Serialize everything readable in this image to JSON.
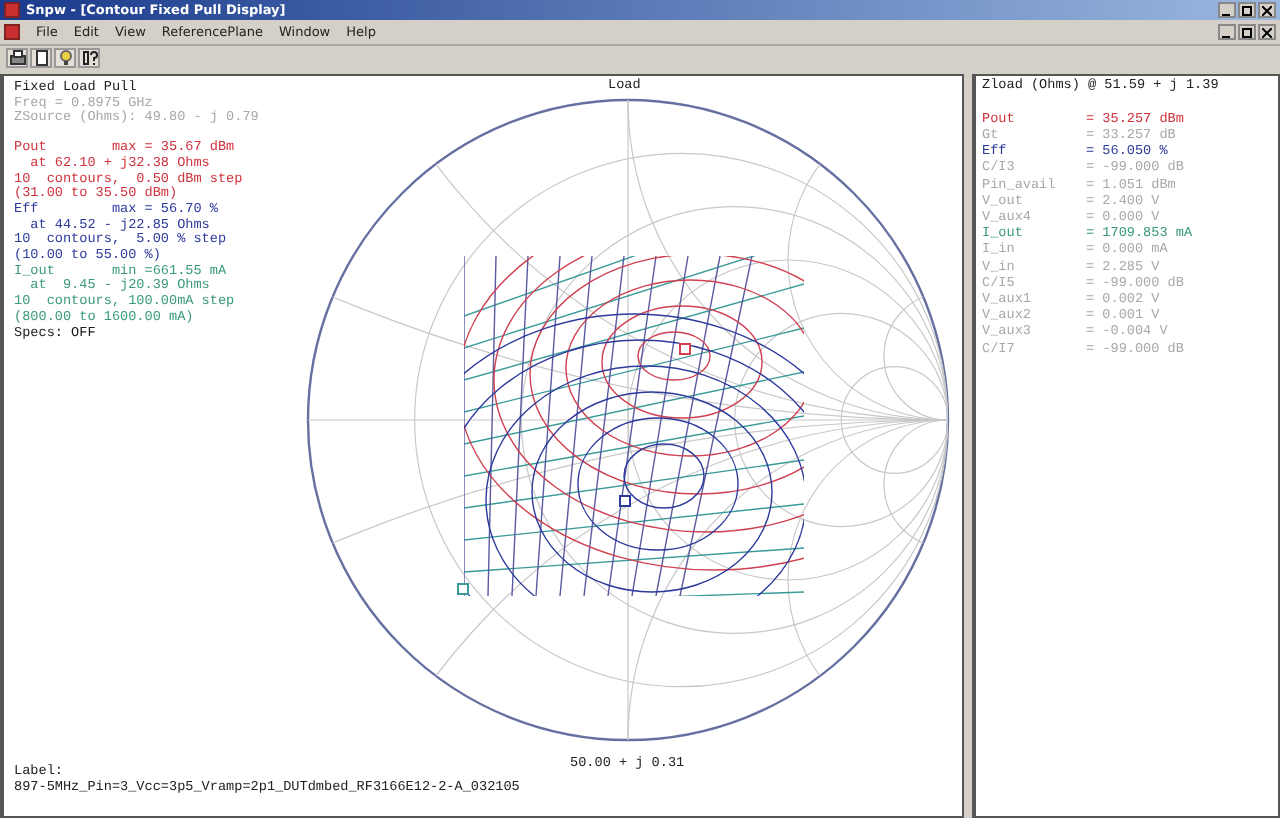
{
  "window": {
    "title": "Snpw - [Contour Fixed Pull Display]"
  },
  "menu": [
    "File",
    "Edit",
    "View",
    "ReferencePlane",
    "Window",
    "Help"
  ],
  "plot": {
    "info": [
      {
        "text": "Fixed Load Pull",
        "color": "#202020"
      },
      {
        "text": "Freq = 0.8975 GHz",
        "color": "#a8a8a8"
      },
      {
        "text": "ZSource (Ohms): 49.80 - j 0.79",
        "color": "#a8a8a8"
      }
    ],
    "results": [
      {
        "text": "Pout        max = 35.67 dBm",
        "color": "#d0323c"
      },
      {
        "text": "  at 62.10 + j32.38 Ohms",
        "color": "#d0323c"
      },
      {
        "text": "10  contours,  0.50 dBm step",
        "color": "#d0323c"
      },
      {
        "text": "(31.00 to 35.50 dBm)",
        "color": "#d0323c"
      },
      {
        "text": "Eff         max = 56.70 %",
        "color": "#2c3a9c"
      },
      {
        "text": "  at 44.52 - j22.85 Ohms",
        "color": "#2c3a9c"
      },
      {
        "text": "10  contours,  5.00 % step",
        "color": "#2c3a9c"
      },
      {
        "text": "(10.00 to 55.00 %)",
        "color": "#2c3a9c"
      },
      {
        "text": "I_out       min =661.55 mA",
        "color": "#3a9a7a"
      },
      {
        "text": "  at  9.45 - j20.39 Ohms",
        "color": "#3a9a7a"
      },
      {
        "text": "10  contours, 100.00mA step",
        "color": "#3a9a7a"
      },
      {
        "text": "(800.00 to 1600.00 mA)",
        "color": "#3a9a7a"
      },
      {
        "text": "Specs: OFF",
        "color": "#202020"
      }
    ],
    "chart_title": "Load",
    "readout": "50.00 + j 0.31",
    "label_caption": "Label:",
    "label_value": "897-5MHz_Pin=3_Vcc=3p5_Vramp=2p1_DUTdmbed_RF3166E12-2-A_032105"
  },
  "side": {
    "header": "Zload (Ohms) @ 51.59 + j 1.39",
    "rows": [
      {
        "name": "Pout",
        "value": "= 35.257 dBm",
        "color": "#d0323c"
      },
      {
        "name": "Gt",
        "value": "= 33.257 dB",
        "color": "#a8a8a8"
      },
      {
        "name": "Eff",
        "value": "= 56.050 %",
        "color": "#2c3a9c"
      },
      {
        "name": "C/I3",
        "value": "= -99.000 dB",
        "color": "#a8a8a8"
      },
      {
        "name": "Pin_avail",
        "value": "= 1.051 dBm",
        "color": "#a8a8a8"
      },
      {
        "name": "V_out",
        "value": "= 2.400 V",
        "color": "#a8a8a8"
      },
      {
        "name": "V_aux4",
        "value": "= 0.000 V",
        "color": "#a8a8a8"
      },
      {
        "name": "I_out",
        "value": "= 1709.853 mA",
        "color": "#3a9a7a"
      },
      {
        "name": "I_in",
        "value": "= 0.000 mA",
        "color": "#a8a8a8"
      },
      {
        "name": "V_in",
        "value": "= 2.285 V",
        "color": "#a8a8a8"
      },
      {
        "name": "C/I5",
        "value": "= -99.000 dB",
        "color": "#a8a8a8"
      },
      {
        "name": "V_aux1",
        "value": "= 0.002 V",
        "color": "#a8a8a8"
      },
      {
        "name": "V_aux2",
        "value": "= 0.001 V",
        "color": "#a8a8a8"
      },
      {
        "name": "V_aux3",
        "value": "= -0.004 V",
        "color": "#a8a8a8"
      },
      {
        "name": "C/I7",
        "value": "= -99.000 dB",
        "color": "#a8a8a8"
      }
    ]
  }
}
